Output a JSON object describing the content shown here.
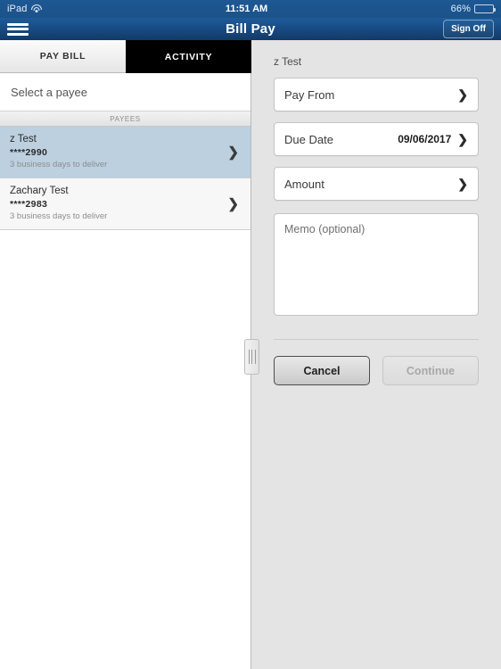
{
  "status_bar": {
    "carrier": "iPad",
    "wifi_icon": "wifi-icon",
    "time": "11:51 AM",
    "battery_percent": "66%",
    "battery_level": 66
  },
  "nav_bar": {
    "menu_icon": "hamburger-menu-icon",
    "title": "Bill Pay",
    "sign_off_label": "Sign Off"
  },
  "tabs": [
    {
      "label": "PAY BILL",
      "selected": true
    },
    {
      "label": "ACTIVITY",
      "selected": false
    }
  ],
  "left_pane": {
    "instruction": "Select a payee",
    "section_header": "PAYEES",
    "payees": [
      {
        "name": "z Test",
        "account": "****2990",
        "delivery": "3 business days to deliver",
        "selected": true,
        "chevron": "chevron-right-icon"
      },
      {
        "name": "Zachary Test",
        "account": "****2983",
        "delivery": "3 business days to deliver",
        "selected": false,
        "chevron": "chevron-right-icon"
      }
    ]
  },
  "form": {
    "title": "z Test",
    "fields": [
      {
        "label": "Pay From",
        "value": "",
        "chevron": "chevron-right-icon"
      },
      {
        "label": "Due Date",
        "value": "09/06/2017",
        "chevron": "chevron-right-icon"
      },
      {
        "label": "Amount",
        "value": "",
        "chevron": "chevron-right-icon"
      }
    ],
    "memo_placeholder": "Memo (optional)",
    "memo_value": "",
    "cancel_label": "Cancel",
    "continue_label": "Continue",
    "continue_disabled": true
  },
  "splitter": {
    "name": "pane-resize-handle"
  },
  "colors": {
    "nav_blue_top": "#1e5c9b",
    "nav_blue_bottom": "#133a66",
    "selected_row": "#bcd0e0",
    "right_pane_bg": "#e4e4e4",
    "tab_unselected_bg": "#000000"
  }
}
